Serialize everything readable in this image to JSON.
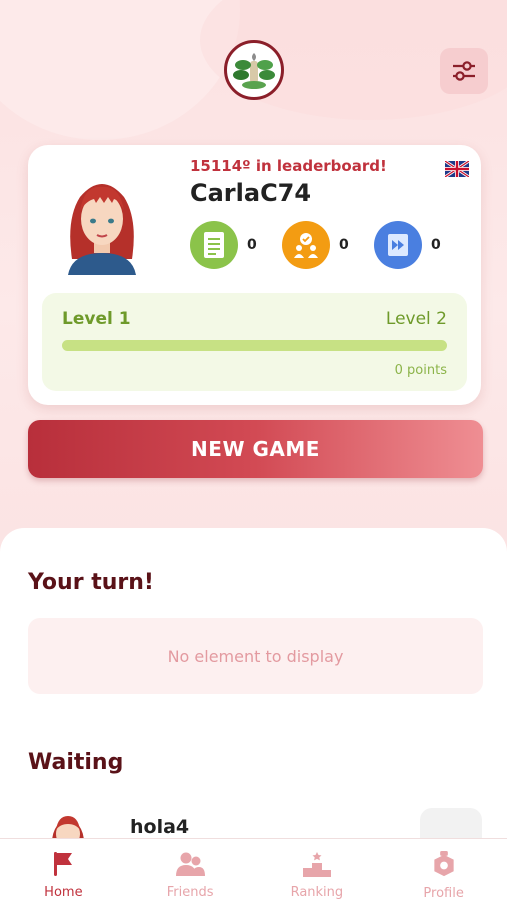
{
  "header": {
    "logo_icon": "medicinal-plant-logo",
    "settings_icon": "sliders-icon"
  },
  "profile": {
    "rank_text": "15114º in leaderboard!",
    "username": "CarlaC74",
    "flag_icon": "uk-flag-icon",
    "stats": [
      {
        "icon": "quiz-sheet-icon",
        "value": "0",
        "color": "#8bc34a"
      },
      {
        "icon": "trophy-people-icon",
        "value": "0",
        "color": "#f39c12"
      },
      {
        "icon": "fast-forward-icon",
        "value": "0",
        "color": "#4a7fe0"
      }
    ],
    "level_current": "Level 1",
    "level_next": "Level 2",
    "level_progress": 0,
    "points": "0 points"
  },
  "actions": {
    "new_game_label": "NEW GAME"
  },
  "your_turn": {
    "title": "Your turn!",
    "empty_text": "No element to display"
  },
  "waiting": {
    "title": "Waiting",
    "items": [
      {
        "name": "hola4"
      }
    ]
  },
  "tabs": [
    {
      "label": "Home",
      "icon": "flag-icon",
      "active": true
    },
    {
      "label": "Friends",
      "icon": "users-icon",
      "active": false
    },
    {
      "label": "Ranking",
      "icon": "podium-icon",
      "active": false
    },
    {
      "label": "Profile",
      "icon": "profile-badge-icon",
      "active": false
    }
  ],
  "colors": {
    "accent": "#c0323d",
    "level_green": "#6e9a2a",
    "tab_inactive": "#e7a5aa"
  }
}
